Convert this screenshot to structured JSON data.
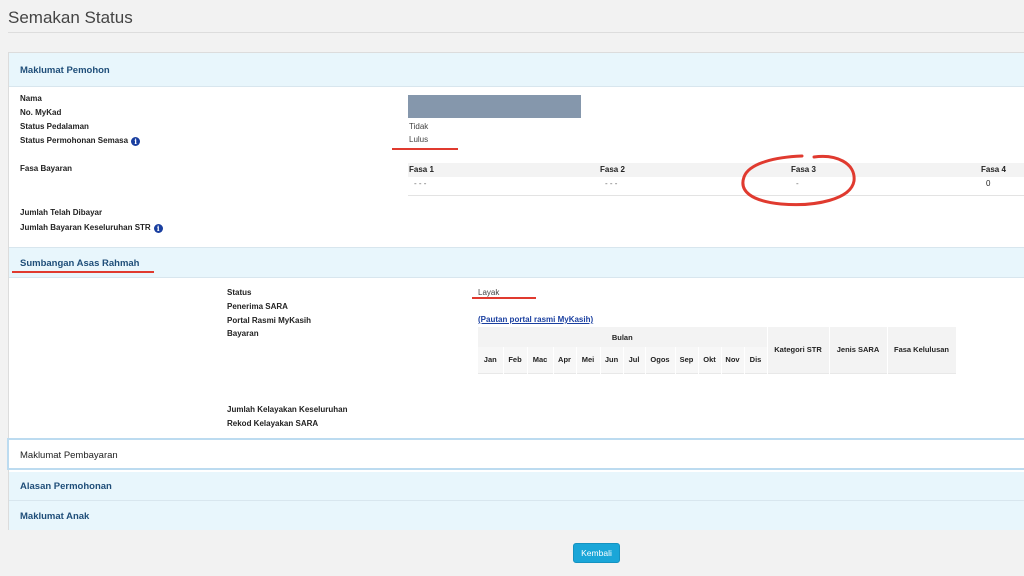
{
  "page": {
    "title": "Semakan Status"
  },
  "pemohon": {
    "section_title": "Maklumat Pemohon",
    "labels": {
      "nama": "Nama",
      "mykad": "No. MyKad",
      "pedalaman": "Status Pedalaman",
      "semasa": "Status Permohonan Semasa",
      "fasa_bayaran": "Fasa Bayaran",
      "jumlah_dibayar": "Jumlah Telah Dibayar",
      "jumlah_keseluruhan": "Jumlah Bayaran Keseluruhan STR"
    },
    "values": {
      "pedalaman": "Tidak",
      "semasa": "Lulus"
    },
    "fasa": {
      "headers": [
        "Fasa 1",
        "Fasa 2",
        "Fasa 3",
        "Fasa 4"
      ],
      "values": [
        "- - -",
        "- - -",
        "-",
        "0"
      ]
    }
  },
  "sara": {
    "section_title": "Sumbangan Asas Rahmah",
    "labels": {
      "status": "Status",
      "penerima": "Penerima SARA",
      "portal": "Portal Rasmi MyKasih",
      "bayaran": "Bayaran",
      "jumlah_kelayakan": "Jumlah Kelayakan Keseluruhan",
      "rekod": "Rekod Kelayakan SARA"
    },
    "values": {
      "status": "Layak"
    },
    "portal_link": "(Pautan portal rasmi MyKasih)",
    "table": {
      "bulan_header": "Bulan",
      "months": [
        "Jan",
        "Feb",
        "Mac",
        "Apr",
        "Mei",
        "Jun",
        "Jul",
        "Ogos",
        "Sep",
        "Okt",
        "Nov",
        "Dis"
      ],
      "extra_headers": [
        "Kategori STR",
        "Jenis SARA",
        "Fasa Kelulusan"
      ]
    }
  },
  "sections": {
    "pembayaran": "Maklumat Pembayaran",
    "alasan": "Alasan Permohonan",
    "anak": "Maklumat Anak"
  },
  "buttons": {
    "kembali": "Kembali"
  },
  "colors": {
    "section_bg": "#e8f6fc",
    "section_text": "#1f4e79",
    "button": "#1aa6d8",
    "annotation": "#e03a2f",
    "masked": "#8597ac"
  }
}
